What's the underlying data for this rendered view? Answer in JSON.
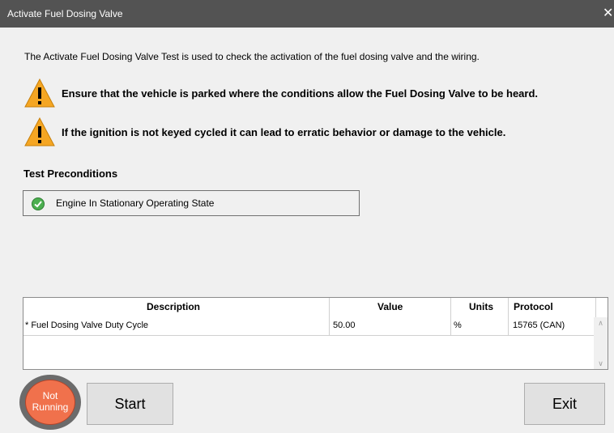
{
  "window": {
    "title": "Activate Fuel Dosing Valve",
    "close_glyph": "✕"
  },
  "intro_text": "The Activate Fuel Dosing Valve Test is used to check the activation of the fuel dosing valve and the wiring.",
  "warnings": [
    {
      "icon": "warning-icon",
      "text": "Ensure that the vehicle is parked where the conditions allow the Fuel Dosing Valve to be heard."
    },
    {
      "icon": "warning-icon",
      "text": "If the ignition is not keyed cycled it can lead to erratic behavior or damage to the vehicle."
    }
  ],
  "preconditions": {
    "title": "Test Preconditions",
    "items": [
      {
        "icon": "check-icon",
        "label": "Engine In Stationary Operating State",
        "status": "passed"
      }
    ]
  },
  "grid": {
    "columns": [
      "Description",
      "Value",
      "Units",
      "Protocol"
    ],
    "rows": [
      {
        "description": "* Fuel Dosing Valve Duty Cycle",
        "value": "50.00",
        "units": "%",
        "protocol": "15765 (CAN)"
      }
    ]
  },
  "status": {
    "line1": "Not",
    "line2": "Running",
    "color": "#f0714c"
  },
  "buttons": {
    "start": "Start",
    "exit": "Exit"
  },
  "colors": {
    "titlebar": "#535353",
    "warning": "#f5a623",
    "check": "#4caf50"
  }
}
